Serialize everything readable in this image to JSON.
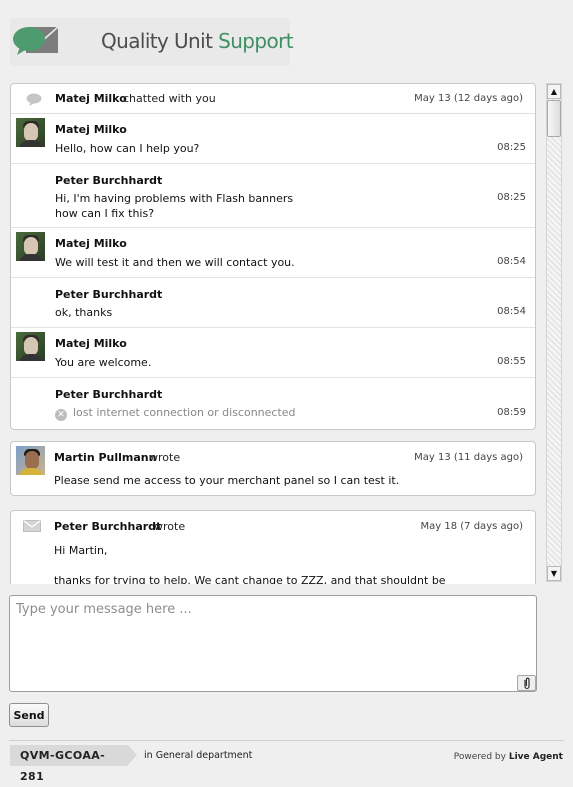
{
  "brand": {
    "name_part1": "Quality Unit",
    "name_part2": "Support"
  },
  "chat_box": {
    "header_name": "Matej Milko",
    "header_action": "chatted with you",
    "header_date": "May 13 (12 days ago)",
    "messages": [
      {
        "author": "Matej Milko",
        "text": "Hello, how can I help you?",
        "time": "08:25"
      },
      {
        "author": "Peter Burchhardt",
        "text_line1": "Hi, I'm having problems with Flash banners",
        "text_line2": "how can I fix this?",
        "time": "08:25"
      },
      {
        "author": "Matej Milko",
        "text": "We will test it and then we will contact you.",
        "time": "08:54"
      },
      {
        "author": "Peter Burchhardt",
        "text": "ok, thanks",
        "time": "08:54"
      },
      {
        "author": "Matej Milko",
        "text": "You are welcome.",
        "time": "08:55"
      },
      {
        "author": "Peter Burchhardt",
        "status": "lost internet connection or disconnected",
        "time": "08:59"
      }
    ]
  },
  "note_box": {
    "author": "Martin Pullmann",
    "action": "wrote",
    "date": "May 13 (11 days ago)",
    "text": "Please send me access to your merchant panel so I can test it."
  },
  "mail_box": {
    "author": "Peter Burchhardt",
    "action": "wrote",
    "date": "May 18 (7 days ago)",
    "line1": "Hi Martin,",
    "line2": "thanks for trying to help. We cant change to ZZZ, and that shouldnt be"
  },
  "composer": {
    "placeholder": "Type your message here ..."
  },
  "send_label": "Send",
  "footer": {
    "ticket_id": "QVM-GCOAA-281",
    "dept_prefix": "in",
    "dept_name": "General",
    "dept_suffix": "department",
    "powered_prefix": "Powered by",
    "powered_brand": "Live Agent"
  },
  "icons": {
    "chat": "chat-bubble-icon",
    "mail": "envelope-icon",
    "disconnected": "x-circle-icon",
    "attach": "paperclip-icon"
  }
}
